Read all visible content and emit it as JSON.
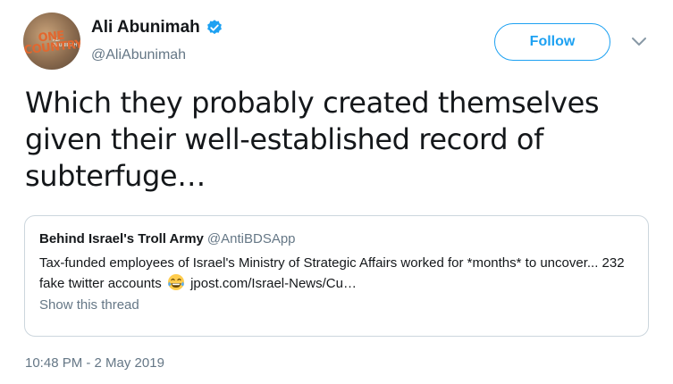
{
  "author": {
    "display_name": "Ali Abunimah",
    "handle": "@AliAbunimah",
    "verified": true,
    "avatar_text": "ONE COUNTRY",
    "avatar_small_text": "ALI ABUNIMAH"
  },
  "follow_label": "Follow",
  "tweet": {
    "text": "Which they probably created themselves given their well-established record of subterfuge…",
    "timestamp": "10:48 PM - 2 May 2019"
  },
  "quoted": {
    "display_name": "Behind Israel's Troll Army",
    "handle": "@AntiBDSApp",
    "text_before_emoji": "Tax-funded employees of Israel's Ministry of Strategic Affairs worked for *months* to uncover... 232 fake twitter accounts",
    "emoji": "face-with-tears-of-joy",
    "link": "jpost.com/Israel-News/Cu…",
    "show_thread_label": "Show this thread"
  },
  "colors": {
    "accent": "#1da1f2",
    "secondary_text": "#657786",
    "border": "#ccd6dd",
    "primary_text": "#14171a"
  }
}
